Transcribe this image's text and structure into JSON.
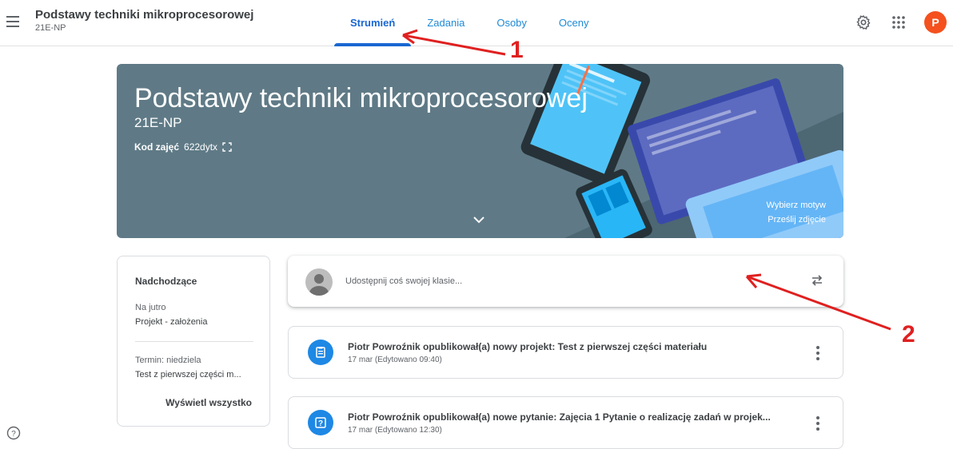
{
  "header": {
    "title": "Podstawy techniki mikroprocesorowej",
    "subtitle": "21E-NP",
    "avatar_letter": "P",
    "tabs": [
      {
        "label": "Strumień",
        "active": true
      },
      {
        "label": "Zadania",
        "active": false
      },
      {
        "label": "Osoby",
        "active": false
      },
      {
        "label": "Oceny",
        "active": false
      }
    ],
    "icons": [
      "menu-icon",
      "settings-gear-icon",
      "apps-grid-icon"
    ]
  },
  "banner": {
    "title": "Podstawy techniki mikroprocesorowej",
    "subtitle": "21E-NP",
    "code_label": "Kod zajęć",
    "code_value": "622dytx",
    "choose_theme": "Wybierz motyw",
    "upload_photo": "Prześlij zdjęcie",
    "colors": {
      "background": "#5f7a86"
    }
  },
  "upcoming": {
    "title": "Nadchodzące",
    "sections": [
      {
        "label": "Na jutro",
        "item": "Projekt - założenia"
      },
      {
        "label": "Termin: niedziela",
        "item": "Test z pierwszej części m..."
      }
    ],
    "view_all": "Wyświetl wszystko"
  },
  "share": {
    "placeholder": "Udostępnij coś swojej klasie..."
  },
  "posts": [
    {
      "icon": "assignment-icon",
      "title": "Piotr Powroźnik opublikował(a) nowy projekt: Test z pierwszej części materiału",
      "date": "17 mar (Edytowano 09:40)"
    },
    {
      "icon": "question-icon",
      "title": "Piotr Powroźnik opublikował(a) nowe pytanie: Zajęcia 1 Pytanie o realizację zadań w projek...",
      "date": "17 mar (Edytowano 12:30)"
    }
  ],
  "annotations": {
    "first": "1",
    "second": "2",
    "color": "#e02020"
  },
  "colors": {
    "accent": "#1967d2",
    "avatar": "#f4511e",
    "post_icon": "#1e88e5"
  }
}
